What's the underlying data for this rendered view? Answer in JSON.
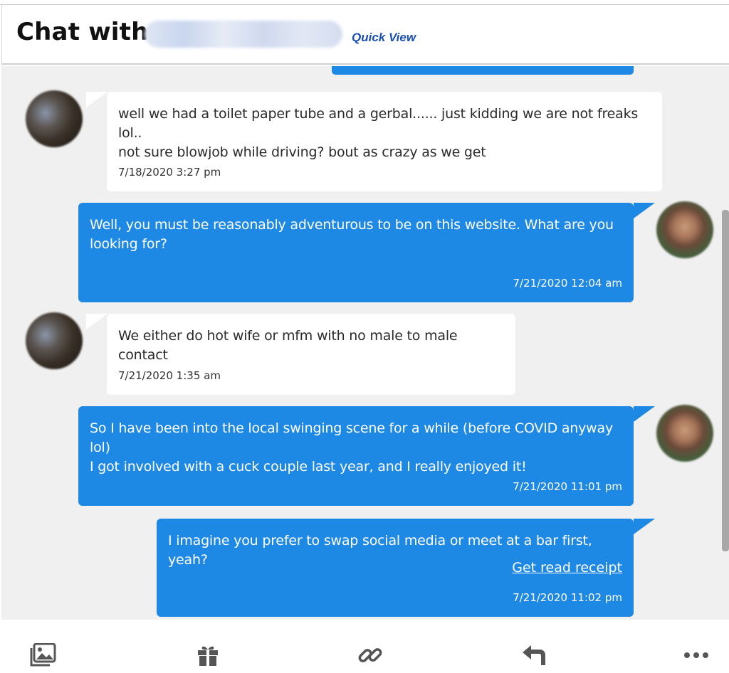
{
  "header": {
    "title": "Chat with",
    "quick_view_label": "Quick View"
  },
  "messages": [
    {
      "from": "them",
      "text_lines": [
        "well we had a toilet paper tube and a gerbal...... just kidding we are not freaks lol..",
        "not sure blowjob while driving? bout as crazy as we get"
      ],
      "time": "7/18/2020 3:27 pm"
    },
    {
      "from": "me",
      "text_lines": [
        "Well, you must be reasonably adventurous to be on this website. What are you",
        "looking for?"
      ],
      "time": "7/21/2020 12:04 am"
    },
    {
      "from": "them",
      "text_lines": [
        "We either do hot wife or mfm with no male to male contact"
      ],
      "time": "7/21/2020 1:35 am"
    },
    {
      "from": "me",
      "text_lines": [
        "So I have been into the local swinging scene for a while (before COVID anyway lol)",
        "I got involved with a cuck couple last year, and I really enjoyed it!"
      ],
      "time": "7/21/2020 11:01 pm"
    },
    {
      "from": "me",
      "text_lines": [
        "I imagine you prefer to swap social media or meet at a bar first, yeah?"
      ],
      "receipt_link": "Get read receipt",
      "time": "7/21/2020 11:02 pm"
    }
  ],
  "toolbar": {
    "items": [
      {
        "icon": "photo-gallery-icon"
      },
      {
        "icon": "gift-icon"
      },
      {
        "icon": "link-icon"
      },
      {
        "icon": "reply-icon"
      },
      {
        "icon": "more-options-icon"
      }
    ]
  },
  "colors": {
    "outgoing_bubble": "#1e88e5",
    "incoming_bubble": "#ffffff",
    "chat_background": "#f0f0f0",
    "quick_view_link": "#1a4fb5"
  }
}
